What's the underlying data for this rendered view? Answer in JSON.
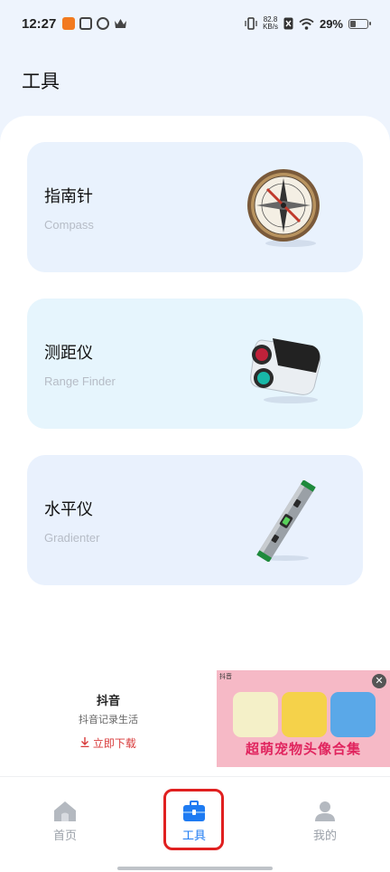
{
  "status_bar": {
    "time": "12:27",
    "net_speed_value": "82.8",
    "net_speed_unit": "KB/s",
    "battery_percent": "29%",
    "battery_level": 0.29
  },
  "page": {
    "title": "工具"
  },
  "tools": [
    {
      "name": "指南针",
      "subtitle": "Compass",
      "bg": "#e9f2fd",
      "icon": "compass-icon"
    },
    {
      "name": "测距仪",
      "subtitle": "Range Finder",
      "bg": "#e6f5fd",
      "icon": "range-finder-icon"
    },
    {
      "name": "水平仪",
      "subtitle": "Gradienter",
      "bg": "#e9f1fd",
      "icon": "level-icon"
    }
  ],
  "ad": {
    "app_name": "抖音",
    "description": "抖音记录生活",
    "download_label": "立即下载",
    "banner_tag": "抖音",
    "banner_title": "超萌宠物头像合集"
  },
  "nav": {
    "items": [
      {
        "label": "首页",
        "icon": "home-icon",
        "active": false
      },
      {
        "label": "工具",
        "icon": "toolbox-icon",
        "active": true
      },
      {
        "label": "我的",
        "icon": "user-icon",
        "active": false
      }
    ]
  },
  "colors": {
    "accent": "#1e7bf2",
    "highlight": "#e02020",
    "page_bg": "#eef4fd"
  }
}
